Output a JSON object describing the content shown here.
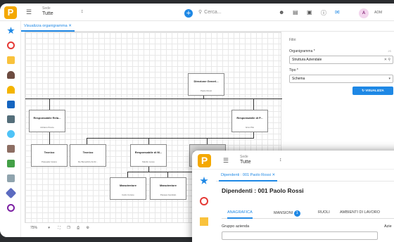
{
  "app": {
    "logo": "P",
    "sede_label": "Sede",
    "sede_value": "Tutte",
    "search_placeholder": "Cerca...",
    "user": "ADM",
    "avatar": "A"
  },
  "main_tab": "Visualizza organigramma",
  "org_nodes": [
    {
      "title": "Direzione Generl...",
      "name": "Paolo Rossi"
    },
    {
      "title": "Responsabile Rela...",
      "name": "Adriano Pesce"
    },
    {
      "title": "Responsabile di P...",
      "name": "Gino Pilo"
    },
    {
      "title": "Tecnico",
      "name": "Pasquale Vetere"
    },
    {
      "title": "Tecnico",
      "name": "De Benedicts Ambr..."
    },
    {
      "title": "Responsabile di M...",
      "name": "Manilo Lusso"
    },
    {
      "title": "Responsabile Prog...",
      "name": ""
    },
    {
      "title": "Manutentore",
      "name": "Carlo Cotone"
    },
    {
      "title": "Manutentore",
      "name": "Pasqua Garofalo"
    }
  ],
  "zoom": "75%",
  "filters": {
    "title": "Filtri",
    "org_label": "Organigramma *",
    "org_value": "Struttura Aziendale",
    "js_label": "JS",
    "type_label": "Tipo *",
    "type_value": "Schema",
    "button": "VISUALIZZA"
  },
  "second_window": {
    "logo": "P",
    "sede_label": "Sede",
    "sede_value": "Tutte",
    "tab": "Dipendenti : 001 Paolo Rossi",
    "title": "Dipendenti : 001 Paolo Rossi",
    "tabs": [
      "ANAGRAFICA",
      "MANSIONI",
      "RUOLI",
      "AMBIENTI DI LAVORO"
    ],
    "mansioni_badge": "1",
    "gruppo_label": "Gruppo azienda",
    "azienda_label": "Azie"
  }
}
